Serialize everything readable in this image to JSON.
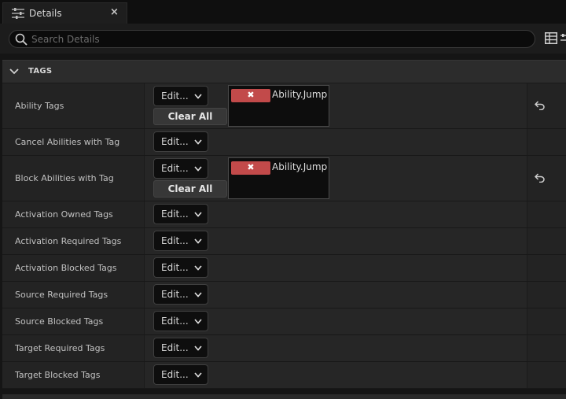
{
  "tab": {
    "icon": "sliders-icon",
    "title": "Details",
    "close": "×"
  },
  "search": {
    "placeholder": "Search Details",
    "icon": "search-icon",
    "value": ""
  },
  "toolbar": {
    "view_icon": "grid-view-icon",
    "settings_icon": "settings-icon"
  },
  "category": {
    "title": "TAGS",
    "expanded": true
  },
  "labels": {
    "edit": "Edit...",
    "clear_all": "Clear All",
    "remove_tag": "✖"
  },
  "rows": [
    {
      "name": "Ability Tags",
      "tags": [
        "Ability.Jump"
      ],
      "reset": true
    },
    {
      "name": "Cancel Abilities with Tag",
      "tags": [],
      "reset": false
    },
    {
      "name": "Block Abilities with Tag",
      "tags": [
        "Ability.Jump"
      ],
      "reset": true
    },
    {
      "name": "Activation Owned Tags",
      "tags": [],
      "reset": false
    },
    {
      "name": "Activation Required Tags",
      "tags": [],
      "reset": false
    },
    {
      "name": "Activation Blocked Tags",
      "tags": [],
      "reset": false
    },
    {
      "name": "Source Required Tags",
      "tags": [],
      "reset": false
    },
    {
      "name": "Source Blocked Tags",
      "tags": [],
      "reset": false
    },
    {
      "name": "Target Required Tags",
      "tags": [],
      "reset": false
    },
    {
      "name": "Target Blocked Tags",
      "tags": [],
      "reset": false
    }
  ],
  "colors": {
    "tag_remove": "#c24a4a",
    "background": "#151515",
    "row": "#232323"
  }
}
